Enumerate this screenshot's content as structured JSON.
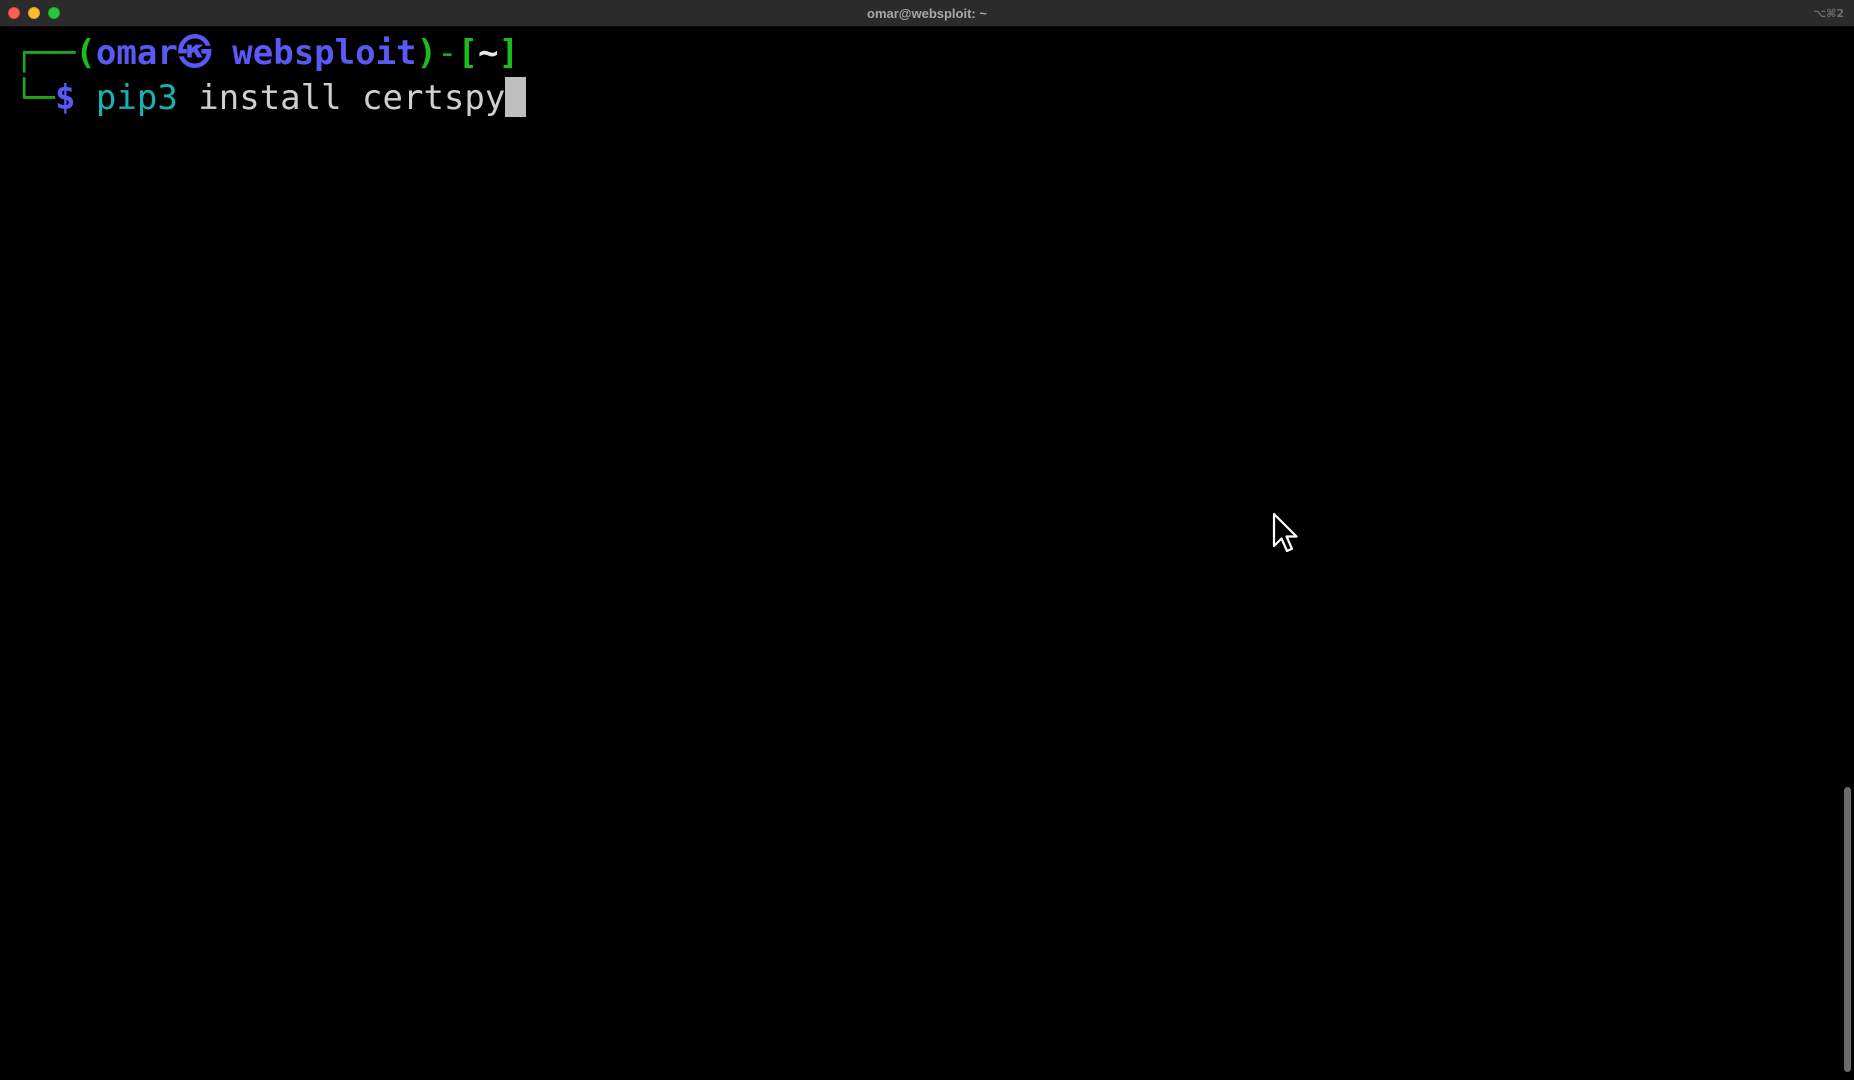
{
  "window": {
    "title": "omar@websploit: ~",
    "shortcut": "⌥⌘2"
  },
  "colors": {
    "background": "#000000",
    "titlebar": "#2b2b2b",
    "prompt_green": "#1bbd1b",
    "prompt_blue": "#5a59f5",
    "command_cyan": "#17b3b3",
    "argument_grey": "#cfcfcf"
  },
  "terminal": {
    "prompt": {
      "box_top": "┌──",
      "open_paren": "(",
      "user": "omar",
      "separator": "㉿",
      "host": "websploit",
      "close_paren": ")",
      "dash": "-",
      "open_bracket": "[",
      "cwd": "~",
      "close_bracket": "]",
      "box_bottom": "└─",
      "symbol": "$"
    },
    "command": "pip3",
    "arguments": "install certspy"
  },
  "icons": {
    "cursor_icon": "mouse-pointer-icon"
  }
}
